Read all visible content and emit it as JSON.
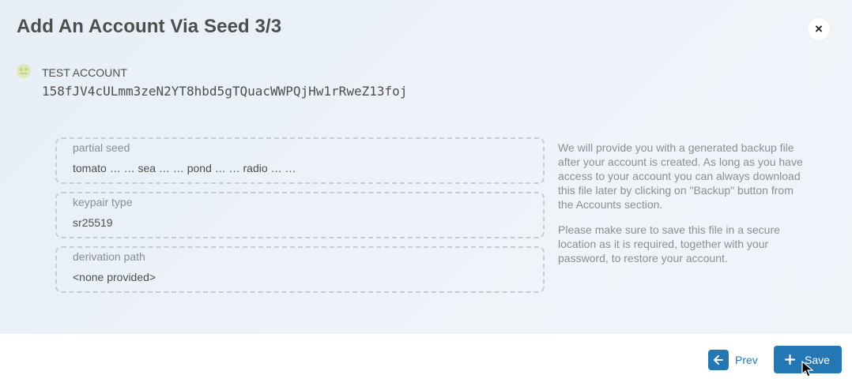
{
  "modal": {
    "title": "Add An Account Via Seed 3/3",
    "close_label": "×"
  },
  "account": {
    "name": "TEST ACCOUNT",
    "address": "158fJV4cULmm3zeN2YT8hbd5gTQuacWWPQjHw1rRweZ13foj"
  },
  "fields": [
    {
      "label": "partial seed",
      "value": "tomato … … sea … … pond … … radio … …"
    },
    {
      "label": "keypair type",
      "value": "sr25519"
    },
    {
      "label": "derivation path",
      "value": "<none provided>"
    }
  ],
  "help": [
    "We will provide you with a generated backup file after your account is created. As long as you have access to your account you can always download this file later by clicking on \"Backup\" button from the Accounts section.",
    "Please make sure to save this file in a secure location as it is required, together with your password, to restore your account."
  ],
  "footer": {
    "prev_label": "Prev",
    "save_label": "Save"
  },
  "colors": {
    "accent": "#2477b3",
    "body_bg": "#e9f0f7",
    "text": "#4e4e4e",
    "muted": "#8a8f95",
    "border": "#c6ccd4"
  },
  "icons": {
    "close": "close-icon",
    "avatar": "identicon-avatar",
    "prev": "arrow-left-icon",
    "save": "plus-icon"
  }
}
